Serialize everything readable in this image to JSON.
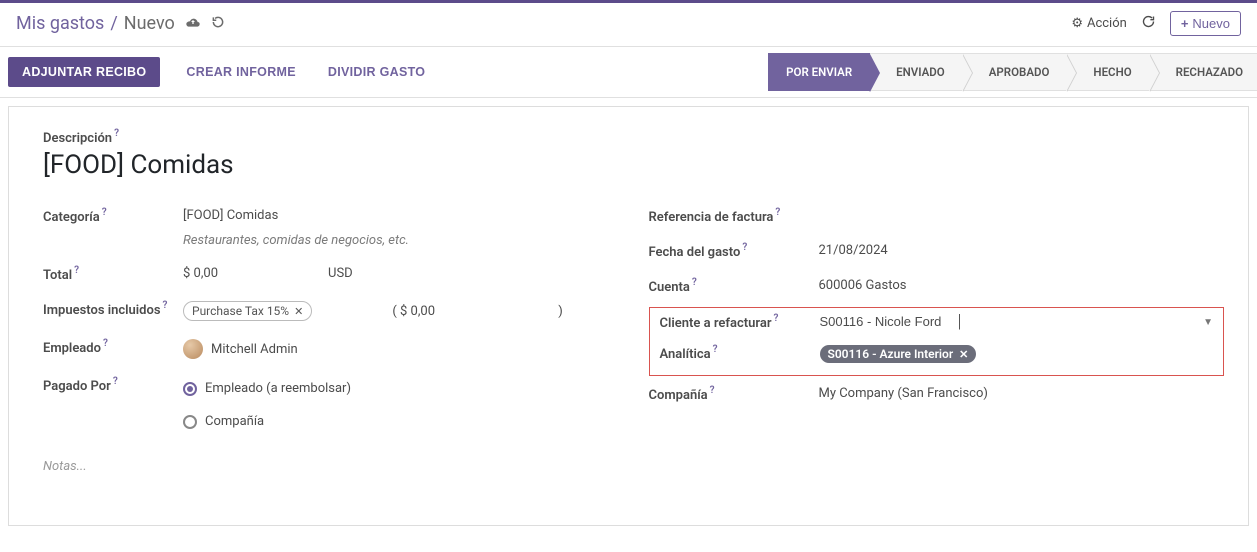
{
  "breadcrumb": {
    "root": "Mis gastos",
    "current": "Nuevo"
  },
  "top": {
    "action_label": "Acción",
    "new_button": "Nuevo"
  },
  "buttons": {
    "attach": "ADJUNTAR RECIBO",
    "create_report": "CREAR INFORME",
    "split": "DIVIDIR GASTO"
  },
  "statuses": {
    "s1": "POR ENVIAR",
    "s2": "ENVIADO",
    "s3": "APROBADO",
    "s4": "HECHO",
    "s5": "RECHAZADO"
  },
  "form": {
    "description_label": "Descripción",
    "description_value": "[FOOD] Comidas",
    "category_label": "Categoría",
    "category_value": "[FOOD] Comidas",
    "category_hint": "Restaurantes, comidas de negocios, etc.",
    "total_label": "Total",
    "total_value": "$ 0,00",
    "currency": "USD",
    "taxes_label": "Impuestos incluidos",
    "tax_tag": "Purchase Tax 15%",
    "taxes_amount_prefix": "( $ 0,00",
    "taxes_amount_suffix": ")",
    "employee_label": "Empleado",
    "employee_value": "Mitchell Admin",
    "paidby_label": "Pagado Por",
    "paidby_opt1": "Empleado (a reembolsar)",
    "paidby_opt2": "Compañía",
    "billref_label": "Referencia de factura",
    "date_label": "Fecha del gasto",
    "date_value": "21/08/2024",
    "account_label": "Cuenta",
    "account_value": "600006 Gastos",
    "client_label": "Cliente a refacturar",
    "client_value": "S00116 - Nicole Ford",
    "analytic_label": "Analítica",
    "analytic_tag": "S00116 - Azure Interior",
    "company_label": "Compañía",
    "company_value": "My Company (San Francisco)",
    "notes_placeholder": "Notas..."
  }
}
